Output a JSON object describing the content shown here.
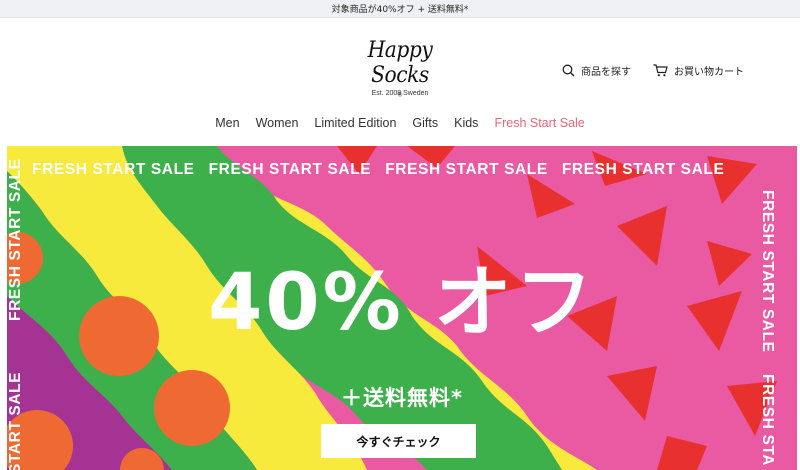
{
  "promo_bar": {
    "text": "対象商品が40%オフ + 送料無料*"
  },
  "brand": {
    "name": "Happy Socks",
    "tagline": "Est. 2008 Sweden"
  },
  "header_actions": {
    "search_label": "商品を探す",
    "cart_label": "お買い物カート"
  },
  "nav": {
    "items": [
      {
        "label": "Men"
      },
      {
        "label": "Women"
      },
      {
        "label": "Limited Edition"
      },
      {
        "label": "Gifts"
      },
      {
        "label": "Kids"
      },
      {
        "label": "Fresh Start Sale"
      }
    ]
  },
  "hero": {
    "marquee_text": "FRESH START SALE",
    "vertical_left": "FRESH START SALE",
    "vertical_left_partial": "START SALE",
    "vertical_right": "FRESH START SALE",
    "vertical_right_partial": "FRESH STA",
    "headline": "40% オフ",
    "subline": "＋送料無料*",
    "cta_label": "今すぐチェック",
    "colors": {
      "pink": "#e95aa3",
      "red": "#e8312f",
      "yellow": "#f7ea3c",
      "green": "#3db04b",
      "purple": "#a53394",
      "orange": "#ee6a32",
      "sale_accent": "#e9657a"
    }
  },
  "icons": {
    "search": "search-icon",
    "cart": "cart-icon"
  }
}
